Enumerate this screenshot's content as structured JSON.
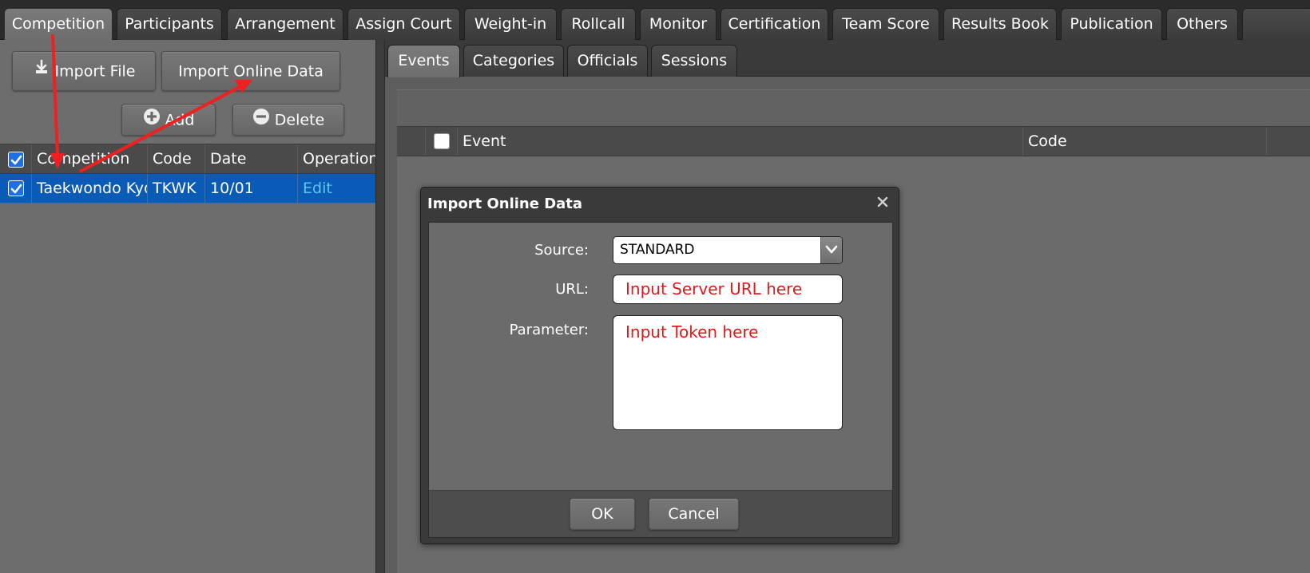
{
  "top_tabs": [
    "Competition",
    "Participants",
    "Arrangement",
    "Assign Court",
    "Weight-in",
    "Rollcall",
    "Monitor",
    "Certification",
    "Team Score",
    "Results Book",
    "Publication",
    "Others"
  ],
  "left": {
    "import_file_label": "Import File",
    "import_online_label": "Import Online Data",
    "add_label": "Add",
    "delete_label": "Delete",
    "grid": {
      "headers": [
        "Competition",
        "Code",
        "Date",
        "Operation"
      ],
      "rows": [
        {
          "selected": true,
          "competition": "Taekwondo Kyorugi",
          "code": "TKWK",
          "date": "10/01",
          "operation": "Edit"
        }
      ]
    }
  },
  "sub_tabs": [
    "Events",
    "Categories",
    "Officials",
    "Sessions"
  ],
  "events_grid": {
    "headers": [
      "Event",
      "Code"
    ]
  },
  "dialog": {
    "title": "Import Online Data",
    "source_label": "Source:",
    "source_value": "STANDARD",
    "url_label": "URL:",
    "url_value": "Input Server URL here",
    "parameter_label": "Parameter:",
    "parameter_value": "Input Token here",
    "ok_label": "OK",
    "cancel_label": "Cancel"
  },
  "colors": {
    "selected_row": "#0a5ab7",
    "link": "#5cc7f2",
    "annotation_arrow": "#f02020",
    "hint_text": "#e0191b"
  },
  "icons": {
    "import_file": "import-file-icon",
    "add": "plus-circle-icon",
    "delete": "minus-circle-icon",
    "close": "close-icon",
    "dropdown": "chevron-down-icon",
    "checkbox": "checkbox-checked-icon"
  }
}
